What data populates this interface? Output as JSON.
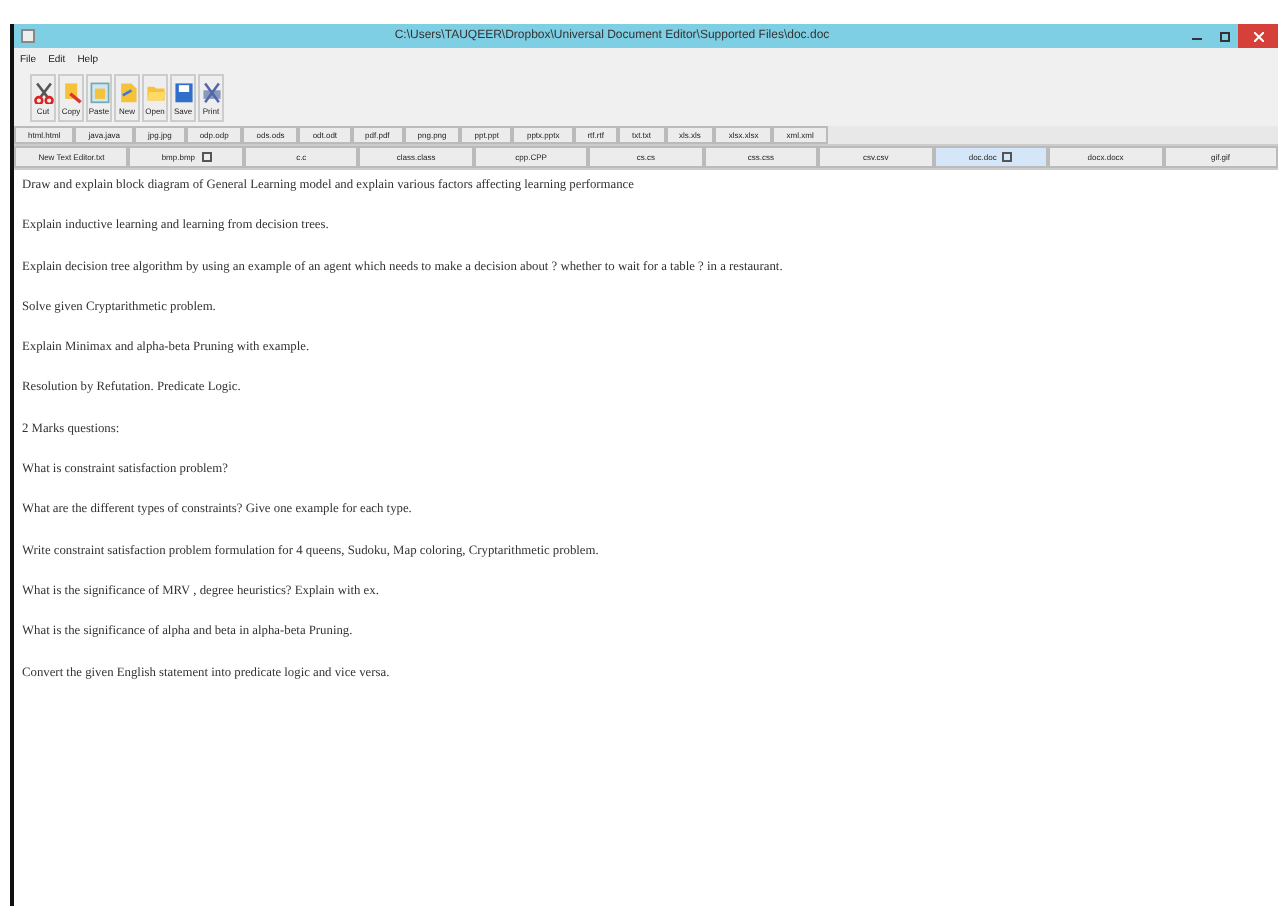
{
  "window": {
    "title": "C:\\Users\\TAUQEER\\Dropbox\\Universal Document Editor\\Supported Files\\doc.doc"
  },
  "menu": [
    "File",
    "Edit",
    "Help"
  ],
  "toolbar": [
    "Cut",
    "Copy",
    "Paste",
    "New",
    "Open",
    "Save",
    "Print"
  ],
  "tab_rows": [
    {
      "tabs": [
        {
          "label": "html.html",
          "selected": false,
          "closable": false
        },
        {
          "label": "java.java",
          "selected": false,
          "closable": false
        },
        {
          "label": "jpg.jpg",
          "selected": false,
          "closable": false
        },
        {
          "label": "odp.odp",
          "selected": false,
          "closable": false
        },
        {
          "label": "ods.ods",
          "selected": false,
          "closable": false
        },
        {
          "label": "odt.odt",
          "selected": false,
          "closable": false
        },
        {
          "label": "pdf.pdf",
          "selected": false,
          "closable": false
        },
        {
          "label": "png.png",
          "selected": false,
          "closable": false
        },
        {
          "label": "ppt.ppt",
          "selected": false,
          "closable": false
        },
        {
          "label": "pptx.pptx",
          "selected": false,
          "closable": false
        },
        {
          "label": "rtf.rtf",
          "selected": false,
          "closable": false
        },
        {
          "label": "txt.txt",
          "selected": false,
          "closable": false
        },
        {
          "label": "xls.xls",
          "selected": false,
          "closable": false
        },
        {
          "label": "xlsx.xlsx",
          "selected": false,
          "closable": false
        },
        {
          "label": "xml.xml",
          "selected": false,
          "closable": false
        }
      ]
    },
    {
      "tabs": [
        {
          "label": "New Text Editor.txt",
          "selected": false,
          "closable": false
        },
        {
          "label": "bmp.bmp",
          "selected": false,
          "closable": true
        },
        {
          "label": "c.c",
          "selected": false,
          "closable": false
        },
        {
          "label": "class.class",
          "selected": false,
          "closable": false
        },
        {
          "label": "cpp.CPP",
          "selected": false,
          "closable": false
        },
        {
          "label": "cs.cs",
          "selected": false,
          "closable": false
        },
        {
          "label": "css.css",
          "selected": false,
          "closable": false
        },
        {
          "label": "csv.csv",
          "selected": false,
          "closable": false
        },
        {
          "label": "doc.doc",
          "selected": true,
          "closable": true
        },
        {
          "label": "docx.docx",
          "selected": false,
          "closable": false
        },
        {
          "label": "gif.gif",
          "selected": false,
          "closable": false
        }
      ]
    }
  ],
  "document": {
    "paragraphs": [
      "Draw and explain block diagram of General Learning model and explain various factors affecting learning performance",
      "Explain inductive learning and learning from decision trees.",
      "Explain decision tree algorithm by using an example of an agent which needs to make a decision about ? whether to wait for a table ? in a restaurant.",
      "Solve given Cryptarithmetic problem.",
      "Explain Minimax and alpha-beta Pruning with example.",
      "Resolution by Refutation. Predicate Logic.",
      "2 Marks questions:",
      "What is constraint satisfaction problem?",
      "What are the different types of constraints? Give one example for each type.",
      "Write constraint satisfaction problem formulation for 4 queens, Sudoku, Map coloring, Cryptarithmetic problem.",
      "What is the significance of MRV , degree heuristics? Explain with ex.",
      "What is the significance of alpha and beta in alpha-beta Pruning.",
      "Convert the given English statement into predicate logic and vice versa."
    ]
  }
}
